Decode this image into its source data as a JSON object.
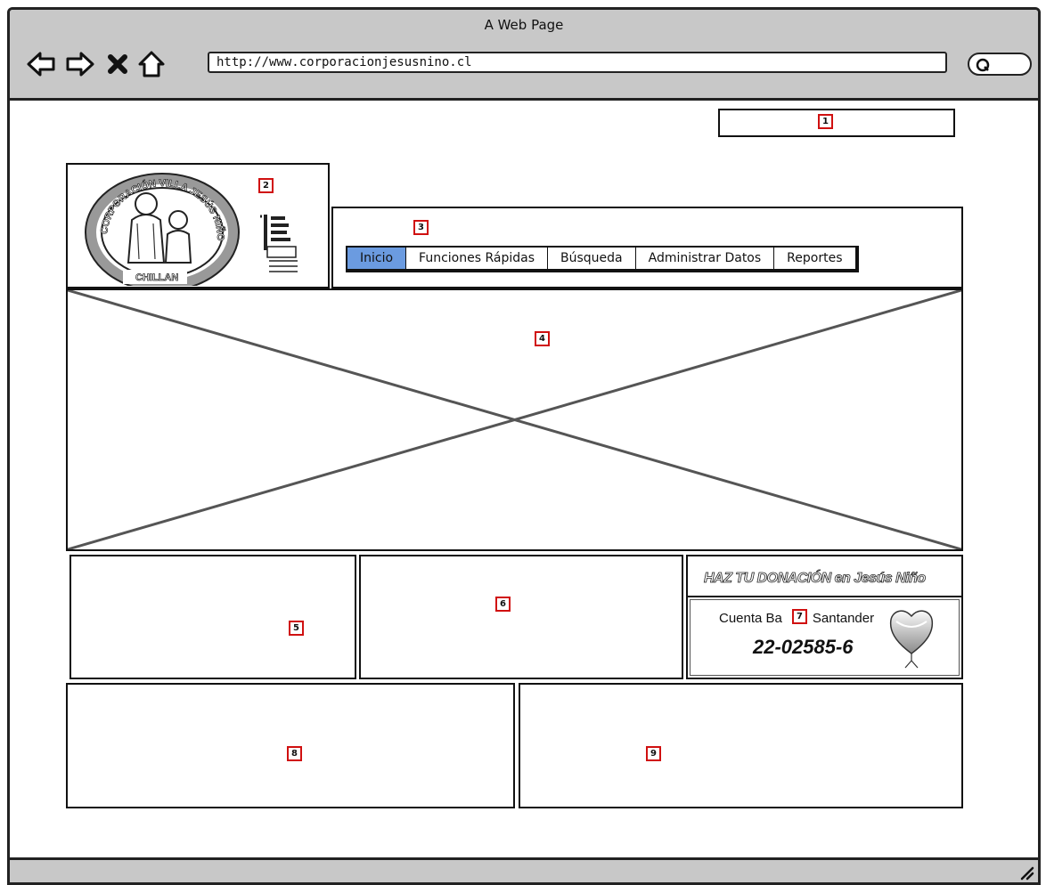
{
  "browser": {
    "title": "A Web Page",
    "url": "http://www.corporacionjesusnino.cl"
  },
  "markers": [
    "1",
    "2",
    "3",
    "4",
    "5",
    "6",
    "7",
    "8",
    "9"
  ],
  "menu": {
    "items": [
      "Inicio",
      "Funciones Rápidas",
      "Búsqueda",
      "Administrar Datos",
      "Reportes"
    ],
    "active_index": 0
  },
  "logo": {
    "ring_top_text": "CORPORACIÓN VILLA JESÚS NIÑO",
    "ring_bottom_text": "CHILLAN"
  },
  "donation": {
    "title": "HAZ TU DONACIÓN en Jesús Niño",
    "bank_label_start": "Cuenta Ba",
    "bank_label_end": "Santander",
    "account_number": "22-02585-6"
  },
  "colors": {
    "chrome": "#c8c8c8",
    "marker_border": "#d01010",
    "active_tab": "#6b9be0"
  }
}
